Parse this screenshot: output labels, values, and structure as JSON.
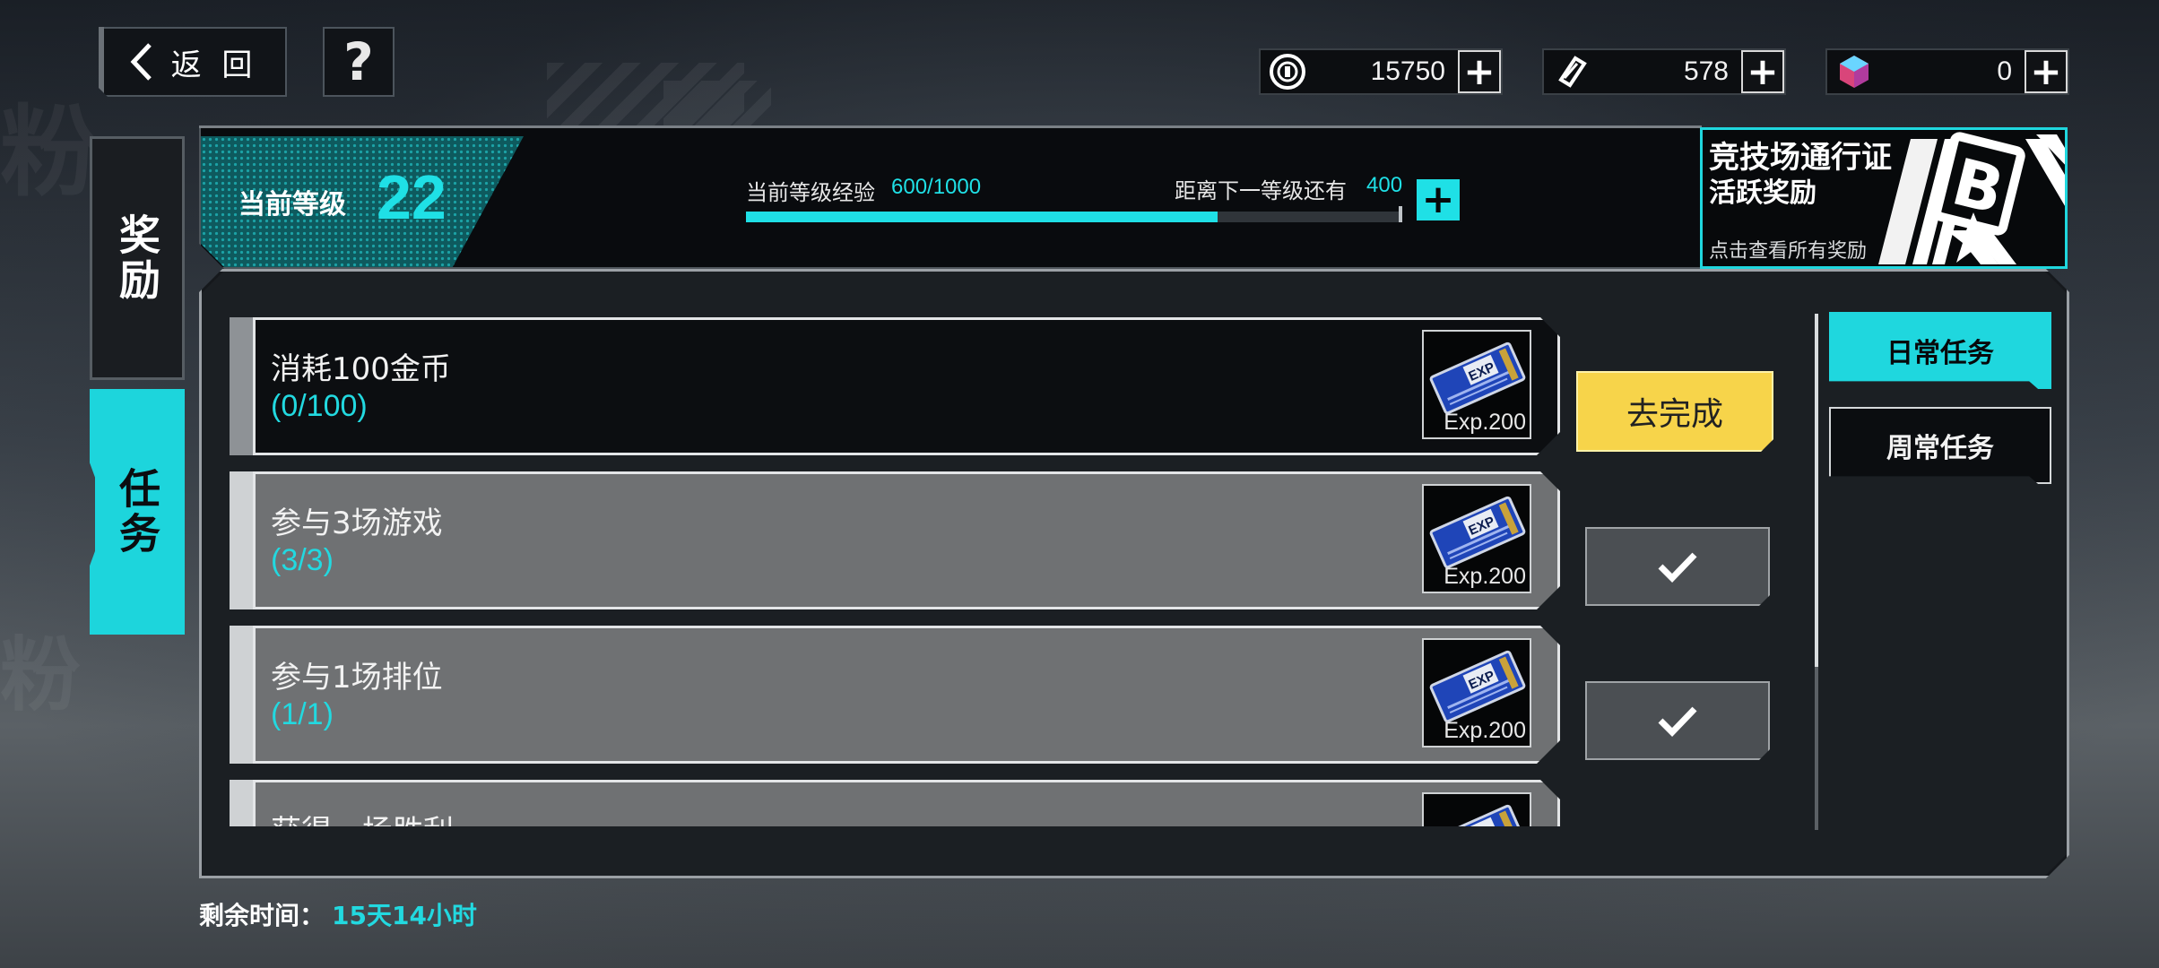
{
  "top_bar": {
    "back_label": "返 回",
    "help_label": "?"
  },
  "currencies": [
    {
      "icon": "coin-icon",
      "value": "15750"
    },
    {
      "icon": "gem-feather-icon",
      "value": "578"
    },
    {
      "icon": "crystal-icon",
      "value": "0"
    }
  ],
  "side_tabs": [
    {
      "label": "奖励",
      "active": false
    },
    {
      "label": "任务",
      "active": true
    }
  ],
  "level": {
    "label": "当前等级",
    "value": "22",
    "exp_label": "当前等级经验",
    "exp_value": "600/1000",
    "exp_progress": 0.6,
    "next_label": "距离下一等级还有",
    "next_value": "400"
  },
  "pass": {
    "title1": "竞技场通行证",
    "title2": "活跃奖励",
    "subtitle": "点击查看所有奖励"
  },
  "tasks": [
    {
      "name": "消耗100金币",
      "progress": "(0/100)",
      "reward": "Exp.200",
      "status": "pending",
      "action_label": "去完成"
    },
    {
      "name": "参与3场游戏",
      "progress": "(3/3)",
      "reward": "Exp.200",
      "status": "done"
    },
    {
      "name": "参与1场排位",
      "progress": "(1/1)",
      "reward": "Exp.200",
      "status": "done"
    },
    {
      "name": "获得一场胜利",
      "progress": "",
      "reward": "",
      "status": "done"
    }
  ],
  "task_tabs": [
    {
      "label": "日常任务",
      "active": true
    },
    {
      "label": "周常任务",
      "active": false
    }
  ],
  "footer": {
    "remain_label": "剩余时间：",
    "remain_value": "15天14小时"
  },
  "colors": {
    "accent": "#1fd7de",
    "go_button": "#f7d44a"
  }
}
